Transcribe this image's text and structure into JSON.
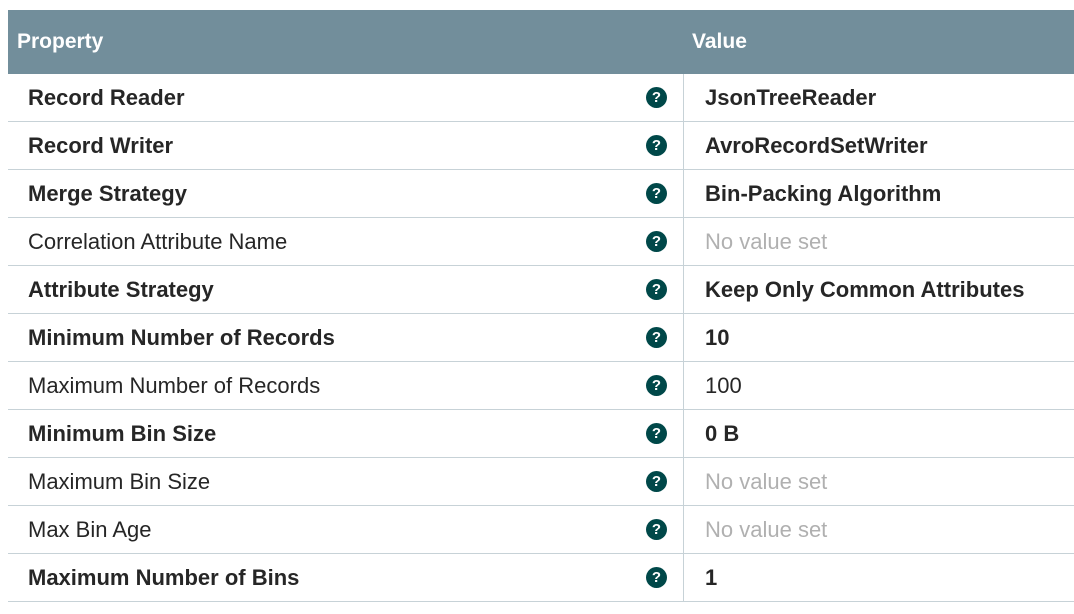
{
  "header": {
    "property": "Property",
    "value": "Value"
  },
  "rows": [
    {
      "name": "Record Reader",
      "value": "JsonTreeReader",
      "required": true,
      "empty": false
    },
    {
      "name": "Record Writer",
      "value": "AvroRecordSetWriter",
      "required": true,
      "empty": false
    },
    {
      "name": "Merge Strategy",
      "value": "Bin-Packing Algorithm",
      "required": true,
      "empty": false
    },
    {
      "name": "Correlation Attribute Name",
      "value": "No value set",
      "required": false,
      "empty": true
    },
    {
      "name": "Attribute Strategy",
      "value": "Keep Only Common Attributes",
      "required": true,
      "empty": false
    },
    {
      "name": "Minimum Number of Records",
      "value": "10",
      "required": true,
      "empty": false
    },
    {
      "name": "Maximum Number of Records",
      "value": "100",
      "required": false,
      "empty": false
    },
    {
      "name": "Minimum Bin Size",
      "value": "0 B",
      "required": true,
      "empty": false
    },
    {
      "name": "Maximum Bin Size",
      "value": "No value set",
      "required": false,
      "empty": true
    },
    {
      "name": "Max Bin Age",
      "value": "No value set",
      "required": false,
      "empty": true
    },
    {
      "name": "Maximum Number of Bins",
      "value": "1",
      "required": true,
      "empty": false
    }
  ],
  "icons": {
    "help": "?"
  },
  "colors": {
    "header_bg": "#728e9b",
    "help_icon": "#004849",
    "empty_value": "#b0b0b0",
    "border": "#c7d2d7"
  }
}
